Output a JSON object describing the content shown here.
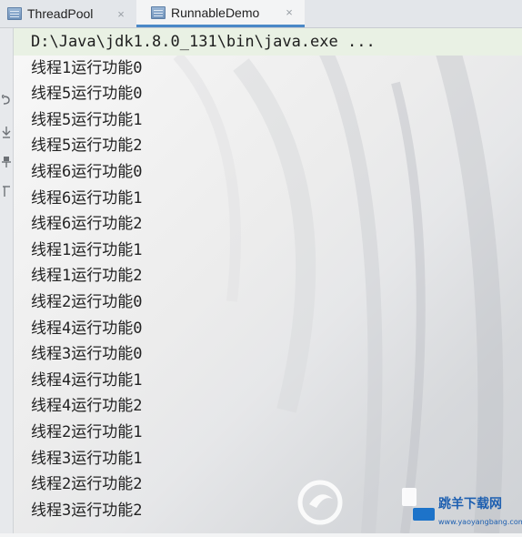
{
  "tabs": [
    {
      "label": "ThreadPool",
      "close": "×",
      "active": false
    },
    {
      "label": "RunnableDemo",
      "close": "×",
      "active": true
    }
  ],
  "console": {
    "command": "D:\\Java\\jdk1.8.0_131\\bin\\java.exe ...",
    "lines": [
      "线程1运行功能0",
      "线程5运行功能0",
      "线程5运行功能1",
      "线程5运行功能2",
      "线程6运行功能0",
      "线程6运行功能1",
      "线程6运行功能2",
      "线程1运行功能1",
      "线程1运行功能2",
      "线程2运行功能0",
      "线程4运行功能0",
      "线程3运行功能0",
      "线程4运行功能1",
      "线程4运行功能2",
      "线程2运行功能1",
      "线程3运行功能1",
      "线程2运行功能2",
      "线程3运行功能2"
    ]
  },
  "gutter": {
    "icons": [
      "rerun-icon",
      "scroll-to-end-icon",
      "pin-icon",
      "print-icon"
    ]
  },
  "watermark": {
    "brand_text": "跳羊下载网",
    "url_text": "www.yaoyangbang.com"
  },
  "colors": {
    "command_bg": "#e9f1e4",
    "active_tab_underline": "#4a88c7",
    "tab_bar_bg": "#e3e6ea"
  }
}
